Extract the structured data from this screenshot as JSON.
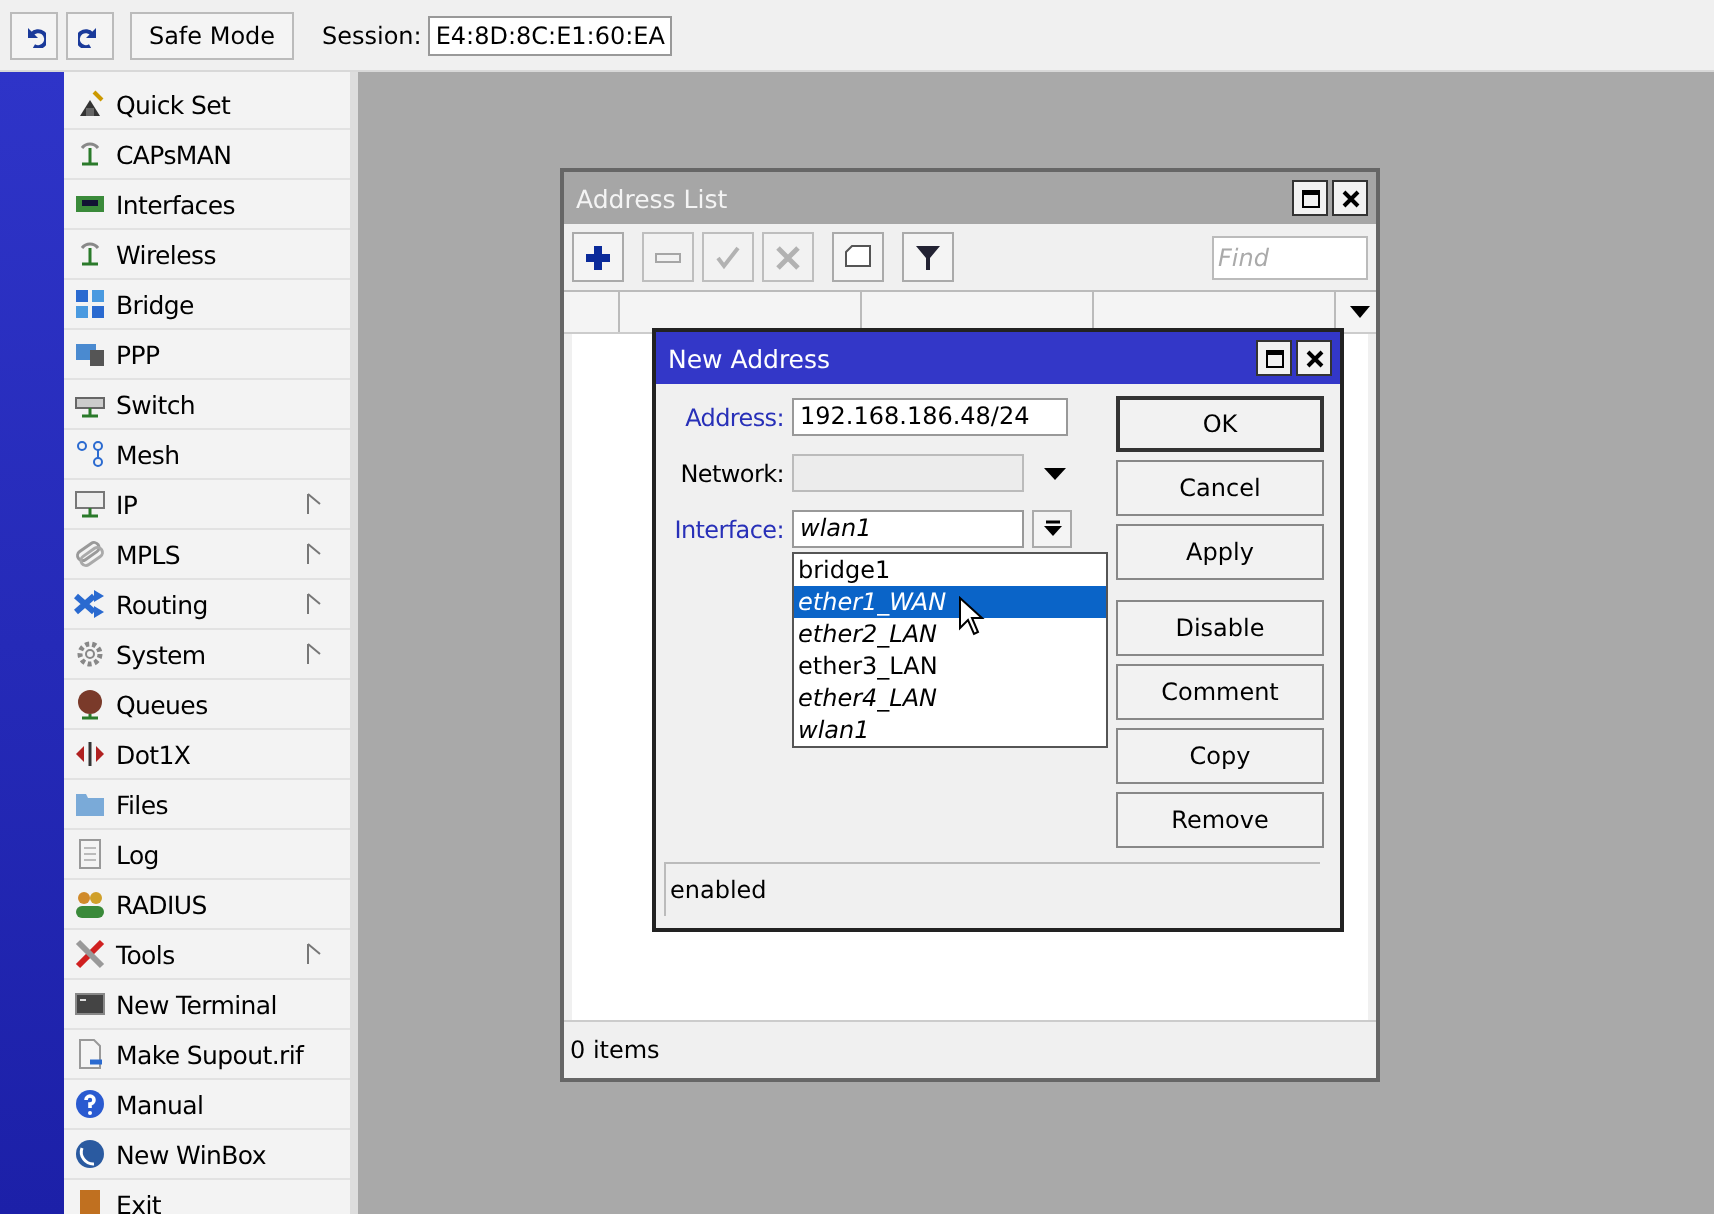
{
  "toolbar": {
    "safe_mode": "Safe Mode",
    "session_label": "Session:",
    "session_value": "E4:8D:8C:E1:60:EA"
  },
  "menu": [
    {
      "label": "Quick Set",
      "submenu": false
    },
    {
      "label": "CAPsMAN",
      "submenu": false
    },
    {
      "label": "Interfaces",
      "submenu": false
    },
    {
      "label": "Wireless",
      "submenu": false
    },
    {
      "label": "Bridge",
      "submenu": false
    },
    {
      "label": "PPP",
      "submenu": false
    },
    {
      "label": "Switch",
      "submenu": false
    },
    {
      "label": "Mesh",
      "submenu": false
    },
    {
      "label": "IP",
      "submenu": true
    },
    {
      "label": "MPLS",
      "submenu": true
    },
    {
      "label": "Routing",
      "submenu": true
    },
    {
      "label": "System",
      "submenu": true
    },
    {
      "label": "Queues",
      "submenu": false
    },
    {
      "label": "Dot1X",
      "submenu": false
    },
    {
      "label": "Files",
      "submenu": false
    },
    {
      "label": "Log",
      "submenu": false
    },
    {
      "label": "RADIUS",
      "submenu": false
    },
    {
      "label": "Tools",
      "submenu": true
    },
    {
      "label": "New Terminal",
      "submenu": false
    },
    {
      "label": "Make Supout.rif",
      "submenu": false
    },
    {
      "label": "Manual",
      "submenu": false
    },
    {
      "label": "New WinBox",
      "submenu": false
    },
    {
      "label": "Exit",
      "submenu": false
    }
  ],
  "address_list": {
    "title": "Address List",
    "active": false,
    "tools": [
      {
        "kind": "add",
        "disabled": false
      },
      {
        "kind": "remove",
        "disabled": true
      },
      {
        "kind": "enable",
        "disabled": true
      },
      {
        "kind": "disable",
        "disabled": true
      },
      {
        "kind": "comment",
        "disabled": false
      },
      {
        "kind": "filter",
        "disabled": false
      }
    ],
    "find": {
      "placeholder": "Find"
    },
    "status": "0 items"
  },
  "new_address": {
    "title": "New Address",
    "active": true,
    "fields": [
      {
        "kind": "text",
        "label": "Address:",
        "modified": true,
        "value": "192.168.186.48/24",
        "italic": false
      },
      {
        "kind": "select",
        "label": "Network:",
        "modified": false,
        "disabled": true
      },
      {
        "kind": "combo",
        "label": "Interface:",
        "modified": true,
        "value": "wlan1",
        "italic": true
      }
    ],
    "options": [
      {
        "label": "bridge1",
        "italic": false,
        "selected": false
      },
      {
        "label": "ether1_WAN",
        "italic": true,
        "selected": true
      },
      {
        "label": "ether2_LAN",
        "italic": true,
        "selected": false
      },
      {
        "label": "ether3_LAN",
        "italic": false,
        "selected": false
      },
      {
        "label": "ether4_LAN",
        "italic": true,
        "selected": false
      },
      {
        "label": "wlan1",
        "italic": true,
        "selected": false
      }
    ],
    "buttons": [
      {
        "label": "OK",
        "default": true
      },
      {
        "label": "Cancel",
        "default": false
      },
      {
        "label": "Apply",
        "default": false
      },
      {
        "label": "Disable",
        "default": false
      },
      {
        "label": "Comment",
        "default": false
      },
      {
        "label": "Copy",
        "default": false
      },
      {
        "label": "Remove",
        "default": false
      }
    ],
    "status": "enabled"
  }
}
